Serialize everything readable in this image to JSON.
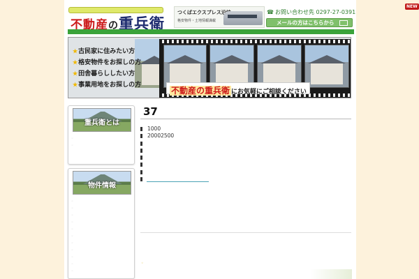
{
  "header": {
    "logo_part1": "不動産",
    "logo_part2": "の",
    "logo_part3": "重兵衛",
    "train_line1": "つくばエクスプレス沿線",
    "train_line2": "格安物件・土地情報満載",
    "contact_label": "お問い合わせ先",
    "phone": "0297-27-0391",
    "mail_button": "メールの方はこちらから"
  },
  "banner": {
    "menu": [
      "古民家に住みたい方",
      "格安物件をお探しの方",
      "田舎暮らししたい方",
      "事業用地をお探しの方"
    ],
    "tagline_brand": "不動産の重兵衛",
    "tagline_rest": "にお気軽にご相談ください"
  },
  "sidebar": {
    "box1_title": "重兵衛とは",
    "box2_title": "物件情報"
  },
  "main": {
    "title": "37",
    "details": [
      "1000",
      "20002500",
      "",
      "",
      "",
      "",
      "",
      ""
    ]
  },
  "badge": "NEW",
  "colors": {
    "accent_green": "#3aa33a",
    "logo_red": "#cc1a1a",
    "background": "#fdf2dc"
  }
}
